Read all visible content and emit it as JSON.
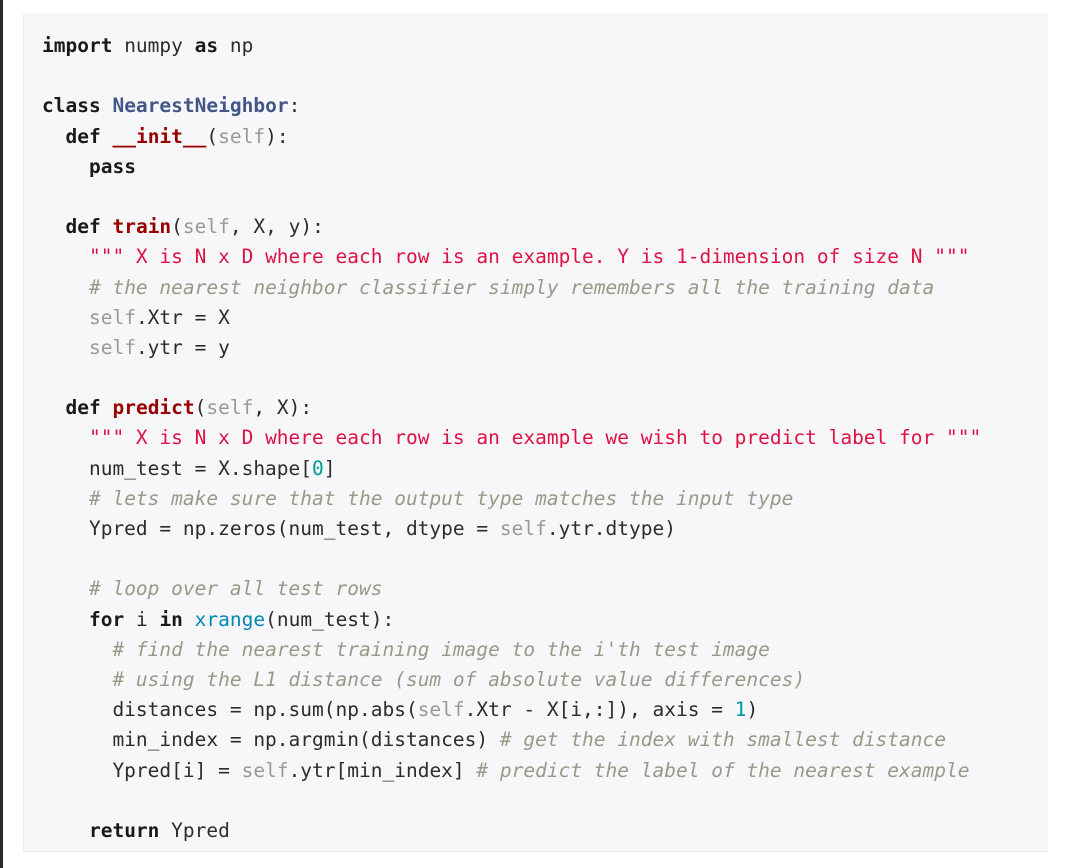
{
  "language": "python",
  "colors": {
    "panel_background": "#f7f7fa",
    "keyword": "#1a1a1a",
    "class_name": "#445588",
    "function_name": "#990000",
    "self": "#999999",
    "string": "#dd1144",
    "comment": "#999988",
    "number": "#009999",
    "builtin": "#0086b3"
  },
  "code_lines": [
    [
      [
        "kw",
        "import"
      ],
      [
        "pln",
        " numpy "
      ],
      [
        "kw",
        "as"
      ],
      [
        "pln",
        " np"
      ]
    ],
    [],
    [
      [
        "kw",
        "class"
      ],
      [
        "pln",
        " "
      ],
      [
        "cls",
        "NearestNeighbor"
      ],
      [
        "pln",
        ":"
      ]
    ],
    [
      [
        "pln",
        "  "
      ],
      [
        "kw",
        "def"
      ],
      [
        "pln",
        " "
      ],
      [
        "fn",
        "__init__"
      ],
      [
        "pln",
        "("
      ],
      [
        "self",
        "self"
      ],
      [
        "pln",
        "):"
      ]
    ],
    [
      [
        "pln",
        "    "
      ],
      [
        "kw",
        "pass"
      ]
    ],
    [],
    [
      [
        "pln",
        "  "
      ],
      [
        "kw",
        "def"
      ],
      [
        "pln",
        " "
      ],
      [
        "fn",
        "train"
      ],
      [
        "pln",
        "("
      ],
      [
        "self",
        "self"
      ],
      [
        "pln",
        ", X, y):"
      ]
    ],
    [
      [
        "pln",
        "    "
      ],
      [
        "str",
        "\"\"\" X is N x D where each row is an example. Y is 1-dimension of size N \"\"\""
      ]
    ],
    [
      [
        "pln",
        "    "
      ],
      [
        "cmt",
        "# the nearest neighbor classifier simply remembers all the training data"
      ]
    ],
    [
      [
        "pln",
        "    "
      ],
      [
        "self",
        "self"
      ],
      [
        "pln",
        ".Xtr = X"
      ]
    ],
    [
      [
        "pln",
        "    "
      ],
      [
        "self",
        "self"
      ],
      [
        "pln",
        ".ytr = y"
      ]
    ],
    [],
    [
      [
        "pln",
        "  "
      ],
      [
        "kw",
        "def"
      ],
      [
        "pln",
        " "
      ],
      [
        "fn",
        "predict"
      ],
      [
        "pln",
        "("
      ],
      [
        "self",
        "self"
      ],
      [
        "pln",
        ", X):"
      ]
    ],
    [
      [
        "pln",
        "    "
      ],
      [
        "str",
        "\"\"\" X is N x D where each row is an example we wish to predict label for \"\"\""
      ]
    ],
    [
      [
        "pln",
        "    num_test = X.shape["
      ],
      [
        "num",
        "0"
      ],
      [
        "pln",
        "]"
      ]
    ],
    [
      [
        "pln",
        "    "
      ],
      [
        "cmt",
        "# lets make sure that the output type matches the input type"
      ]
    ],
    [
      [
        "pln",
        "    Ypred = np.zeros(num_test, dtype = "
      ],
      [
        "self",
        "self"
      ],
      [
        "pln",
        ".ytr.dtype)"
      ]
    ],
    [],
    [
      [
        "pln",
        "    "
      ],
      [
        "cmt",
        "# loop over all test rows"
      ]
    ],
    [
      [
        "pln",
        "    "
      ],
      [
        "kw",
        "for"
      ],
      [
        "pln",
        " i "
      ],
      [
        "kw",
        "in"
      ],
      [
        "pln",
        " "
      ],
      [
        "bi",
        "xrange"
      ],
      [
        "pln",
        "(num_test):"
      ]
    ],
    [
      [
        "pln",
        "      "
      ],
      [
        "cmt",
        "# find the nearest training image to the i'th test image"
      ]
    ],
    [
      [
        "pln",
        "      "
      ],
      [
        "cmt",
        "# using the L1 distance (sum of absolute value differences)"
      ]
    ],
    [
      [
        "pln",
        "      distances = np.sum(np.abs("
      ],
      [
        "self",
        "self"
      ],
      [
        "pln",
        ".Xtr - X[i,:]), axis = "
      ],
      [
        "num",
        "1"
      ],
      [
        "pln",
        ")"
      ]
    ],
    [
      [
        "pln",
        "      min_index = np.argmin(distances) "
      ],
      [
        "cmt",
        "# get the index with smallest distance"
      ]
    ],
    [
      [
        "pln",
        "      Ypred[i] = "
      ],
      [
        "self",
        "self"
      ],
      [
        "pln",
        ".ytr[min_index] "
      ],
      [
        "cmt",
        "# predict the label of the nearest example"
      ]
    ],
    [],
    [
      [
        "pln",
        "    "
      ],
      [
        "kw",
        "return"
      ],
      [
        "pln",
        " Ypred"
      ]
    ]
  ]
}
